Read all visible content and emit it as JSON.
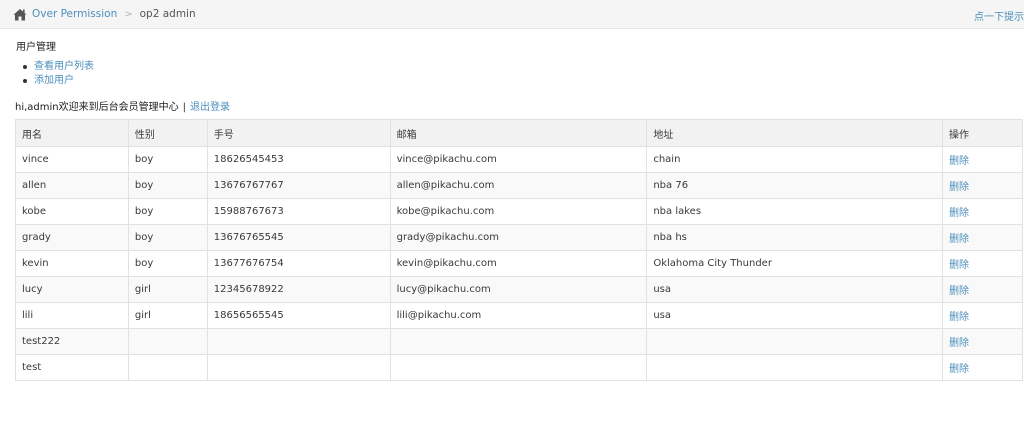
{
  "breadcrumb": {
    "home_label": "Over Permission",
    "separator": ">",
    "current": "op2 admin"
  },
  "header": {
    "hint_link": "点一下提示"
  },
  "section": {
    "title": "用户管理"
  },
  "menu": {
    "items": [
      {
        "label": "查看用户列表"
      },
      {
        "label": "添加用户"
      }
    ]
  },
  "welcome": {
    "text": "hi,admin欢迎来到后台会员管理中心",
    "separator": "|",
    "logout": "退出登录"
  },
  "table": {
    "headers": {
      "name": "用名",
      "sex": "性别",
      "phone": "手号",
      "email": "邮箱",
      "address": "地址",
      "action": "操作"
    },
    "delete_label": "删除",
    "rows": [
      {
        "name": "vince",
        "sex": "boy",
        "phone": "18626545453",
        "email": "vince@pikachu.com",
        "address": "chain"
      },
      {
        "name": "allen",
        "sex": "boy",
        "phone": "13676767767",
        "email": "allen@pikachu.com",
        "address": "nba 76"
      },
      {
        "name": "kobe",
        "sex": "boy",
        "phone": "15988767673",
        "email": "kobe@pikachu.com",
        "address": "nba lakes"
      },
      {
        "name": "grady",
        "sex": "boy",
        "phone": "13676765545",
        "email": "grady@pikachu.com",
        "address": "nba hs"
      },
      {
        "name": "kevin",
        "sex": "boy",
        "phone": "13677676754",
        "email": "kevin@pikachu.com",
        "address": "Oklahoma City Thunder"
      },
      {
        "name": "lucy",
        "sex": "girl",
        "phone": "12345678922",
        "email": "lucy@pikachu.com",
        "address": "usa"
      },
      {
        "name": "lili",
        "sex": "girl",
        "phone": "18656565545",
        "email": "lili@pikachu.com",
        "address": "usa"
      },
      {
        "name": "test222",
        "sex": "",
        "phone": "",
        "email": "",
        "address": ""
      },
      {
        "name": "test",
        "sex": "",
        "phone": "",
        "email": "",
        "address": ""
      }
    ]
  },
  "colors": {
    "link": "#4c8fbd",
    "topbar_bg": "#f5f5f5",
    "header_row_bg": "#f2f2f2",
    "border": "#e1e1e1"
  },
  "icons": {
    "home": "home-icon"
  }
}
